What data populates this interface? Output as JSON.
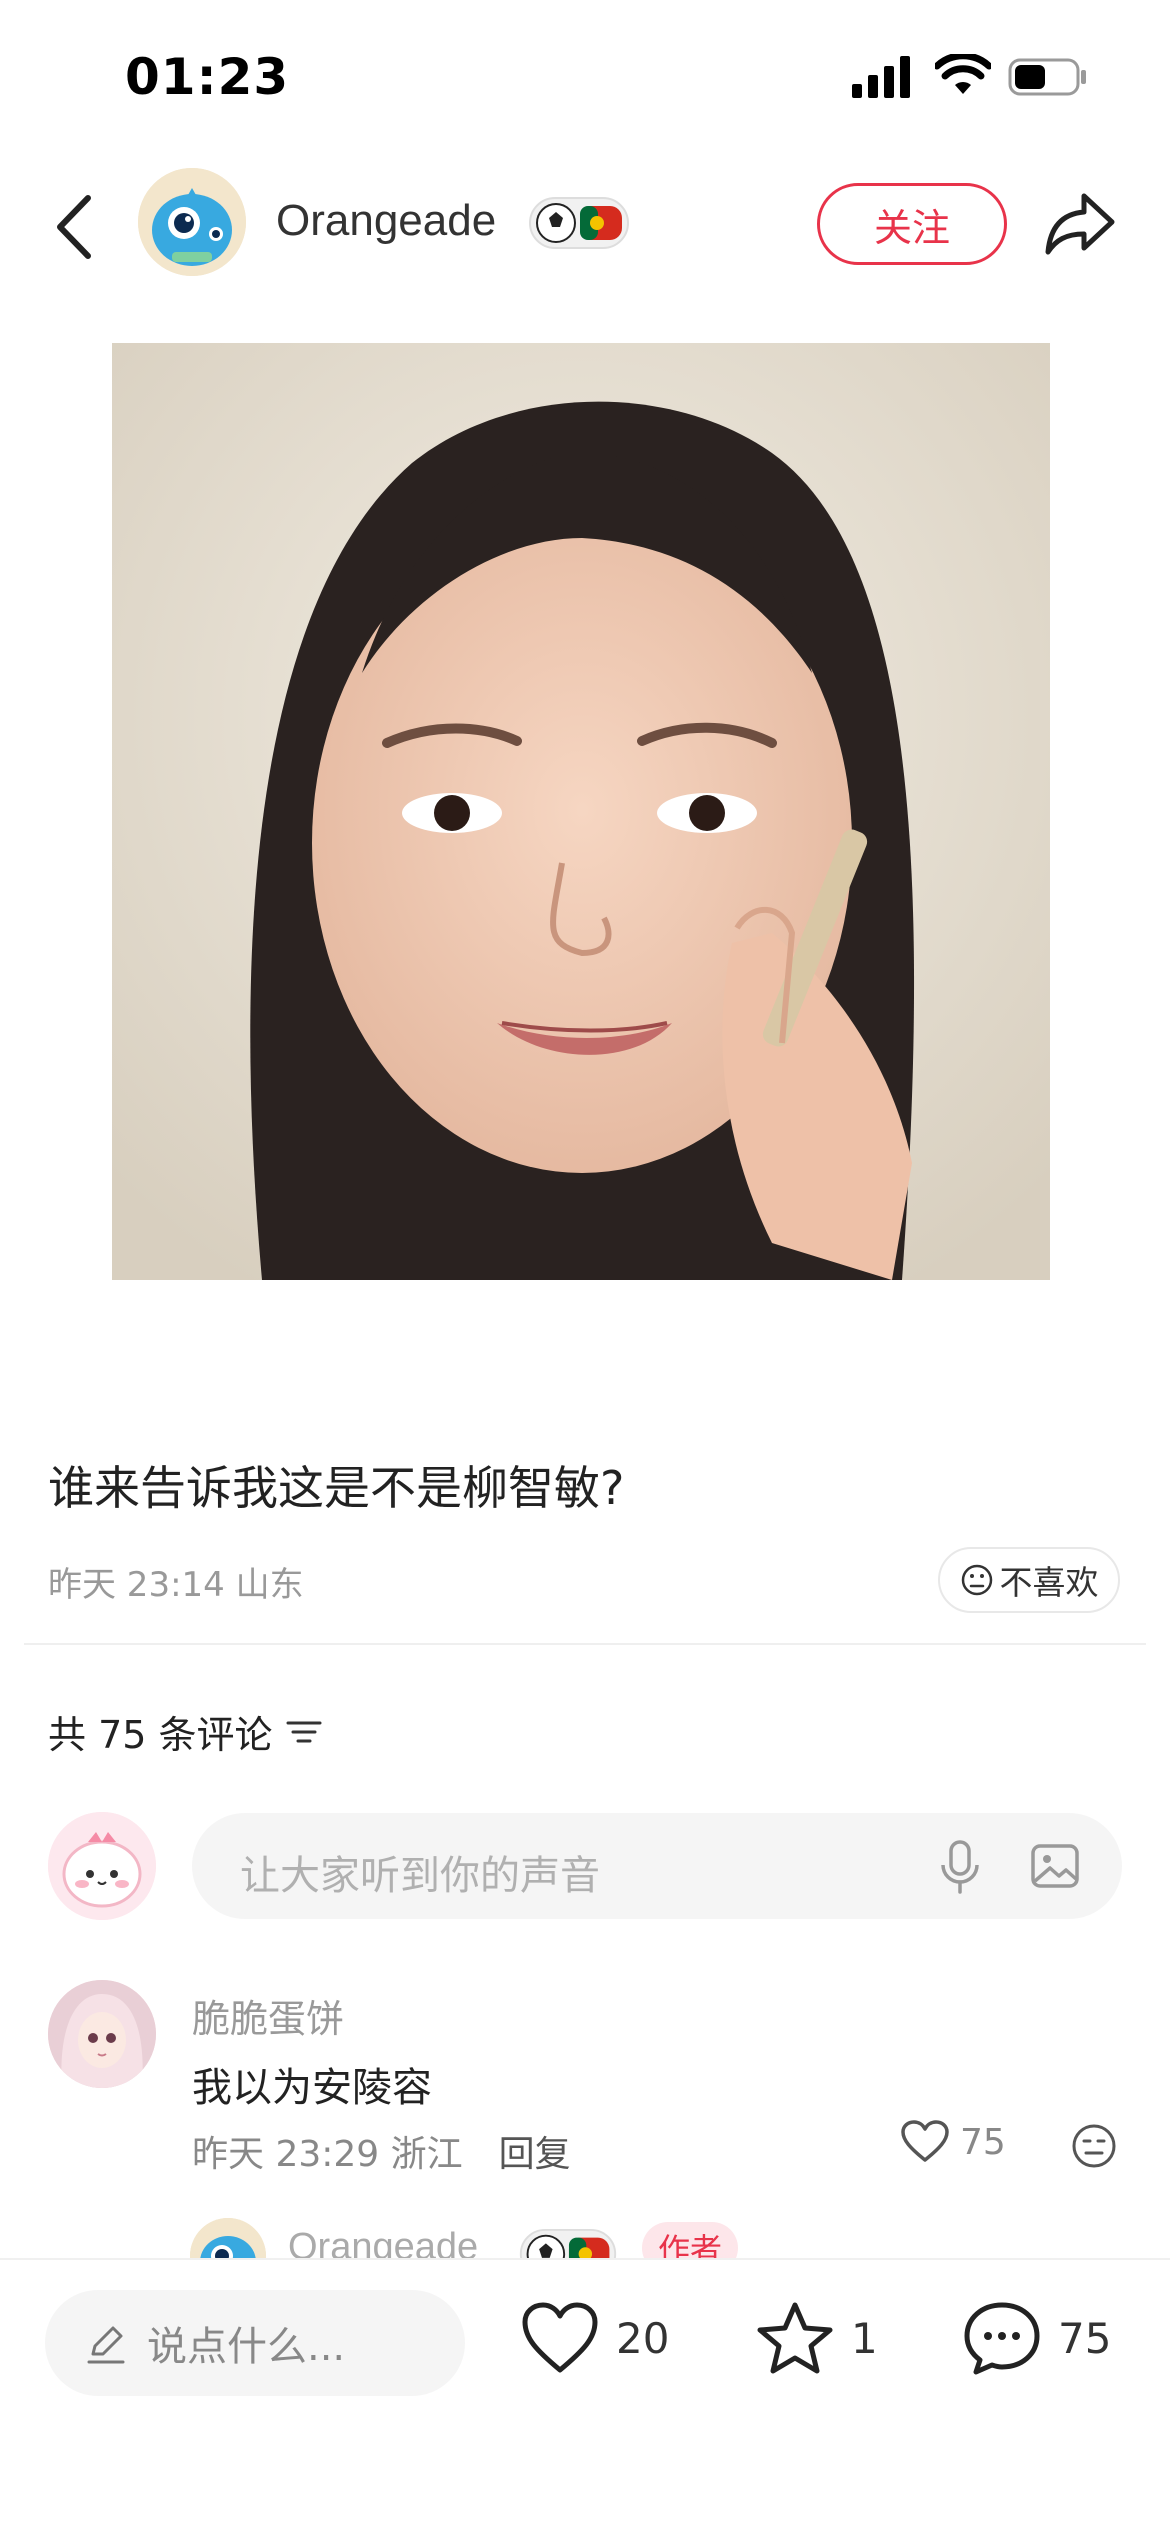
{
  "status_bar": {
    "time": "01:23"
  },
  "header": {
    "username": "Orangeade",
    "follow_label": "关注"
  },
  "post": {
    "text": "谁来告诉我这是不是柳智敏?",
    "meta": "昨天 23:14 山东",
    "dislike_label": "不喜欢"
  },
  "comments": {
    "count_label": "共 75 条评论",
    "input_placeholder": "让大家听到你的声音",
    "items": [
      {
        "author": "脆脆蛋饼",
        "text": "我以为安陵容",
        "time_location": "昨天 23:29 浙江",
        "reply_label": "回复",
        "likes": "75"
      }
    ],
    "sub_reply": {
      "author": "Orangeade",
      "tag": "作者"
    }
  },
  "bottom_bar": {
    "say_placeholder": "说点什么...",
    "likes": "20",
    "favorites": "1",
    "comments": "75"
  },
  "colors": {
    "accent": "#e8334a",
    "muted": "#999999"
  }
}
